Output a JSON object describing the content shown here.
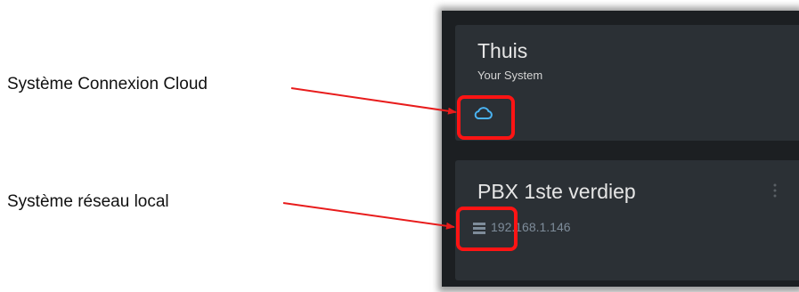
{
  "annotations": {
    "cloud_label": "Système Connexion Cloud",
    "local_label": "Système réseau local",
    "highlight_color": "#ff1414",
    "arrow_color": "#e81c1c"
  },
  "systems": [
    {
      "title": "Thuis",
      "subtitle": "Your System",
      "connection_icon": "cloud-icon",
      "accent_color": "#4ab3f2"
    },
    {
      "title": "PBX 1ste verdiep",
      "address": "192.168.1.146",
      "connection_icon": "server-icon",
      "menu_icon": "kebab-menu-icon"
    }
  ]
}
